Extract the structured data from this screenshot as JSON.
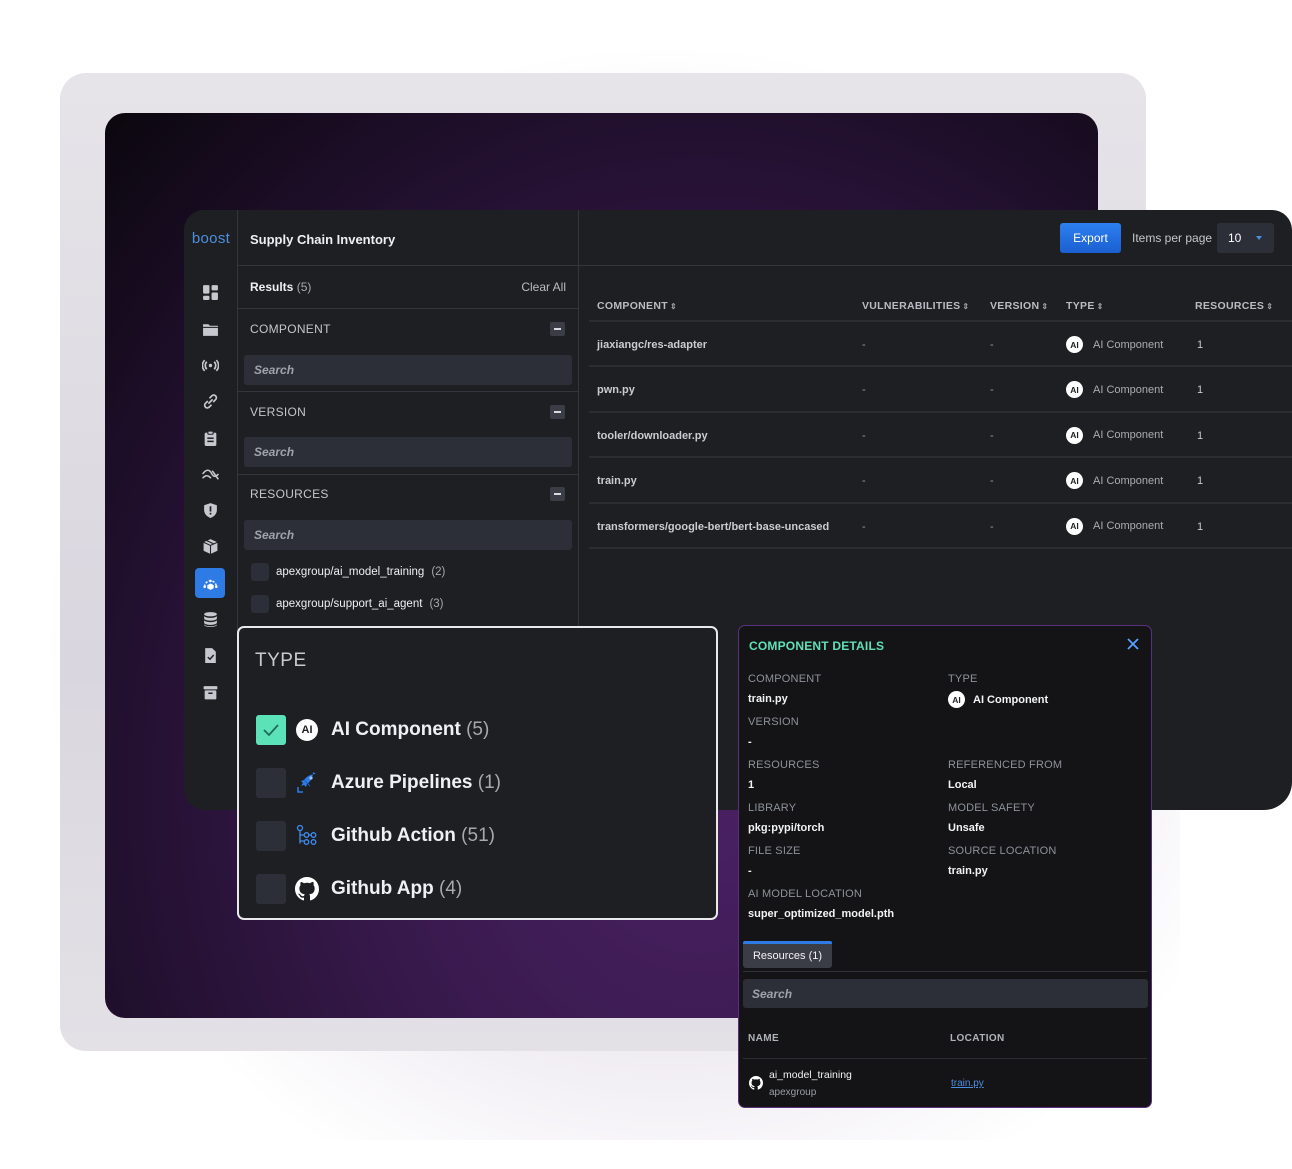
{
  "app": {
    "logo": "boost",
    "page_title": "Supply Chain Inventory",
    "accent_color": "#2f7be6"
  },
  "sidebar": {
    "items": [
      {
        "icon": "dashboard-icon",
        "active": false
      },
      {
        "icon": "folder-icon",
        "active": false
      },
      {
        "icon": "broadcast-icon",
        "active": false
      },
      {
        "icon": "link-icon",
        "active": false
      },
      {
        "icon": "clipboard-icon",
        "active": false
      },
      {
        "icon": "trend-icon",
        "active": false
      },
      {
        "icon": "shield-alert-icon",
        "active": false
      },
      {
        "icon": "package-icon",
        "active": false
      },
      {
        "icon": "supply-chain-icon",
        "active": true
      },
      {
        "icon": "database-icon",
        "active": false
      },
      {
        "icon": "file-check-icon",
        "active": false
      },
      {
        "icon": "archive-icon",
        "active": false
      }
    ]
  },
  "filters": {
    "results_label": "Results",
    "results_count": "(5)",
    "clear_all": "Clear All",
    "sections": [
      {
        "title": "COMPONENT",
        "search_placeholder": "Search"
      },
      {
        "title": "VERSION",
        "search_placeholder": "Search"
      },
      {
        "title": "RESOURCES",
        "search_placeholder": "Search"
      }
    ],
    "resources": [
      {
        "name": "apexgroup/ai_model_training",
        "count": "(2)",
        "checked": false
      },
      {
        "name": "apexgroup/support_ai_agent",
        "count": "(3)",
        "checked": false
      }
    ]
  },
  "toolbar": {
    "export_label": "Export",
    "items_per_page_label": "Items per page",
    "items_per_page_value": "10"
  },
  "table": {
    "columns": [
      "COMPONENT",
      "VULNERABILITIES",
      "VERSION",
      "TYPE",
      "RESOURCES"
    ],
    "rows": [
      {
        "component": "jiaxiangc/res-adapter",
        "vulnerabilities": "-",
        "version": "-",
        "type": "AI Component",
        "resources": "1"
      },
      {
        "component": "pwn.py",
        "vulnerabilities": "-",
        "version": "-",
        "type": "AI Component",
        "resources": "1"
      },
      {
        "component": "tooler/downloader.py",
        "vulnerabilities": "-",
        "version": "-",
        "type": "AI Component",
        "resources": "1"
      },
      {
        "component": "train.py",
        "vulnerabilities": "-",
        "version": "-",
        "type": "AI Component",
        "resources": "1"
      },
      {
        "component": "transformers/google-bert/bert-base-uncased",
        "vulnerabilities": "-",
        "version": "-",
        "type": "AI Component",
        "resources": "1"
      }
    ],
    "ai_badge": "AI"
  },
  "type_filter": {
    "title": "TYPE",
    "options": [
      {
        "label": "AI Component",
        "count": "(5)",
        "checked": true,
        "icon": "ai-icon"
      },
      {
        "label": "Azure Pipelines",
        "count": "(1)",
        "checked": false,
        "icon": "azure-pipelines-icon"
      },
      {
        "label": "Github Action",
        "count": "(51)",
        "checked": false,
        "icon": "github-action-icon"
      },
      {
        "label": "Github App",
        "count": "(4)",
        "checked": false,
        "icon": "github-icon"
      }
    ],
    "check_color": "#5be3b7"
  },
  "details": {
    "title": "COMPONENT DETAILS",
    "title_color": "#5fe0b7",
    "fields": {
      "component": {
        "label": "COMPONENT",
        "value": "train.py"
      },
      "type": {
        "label": "TYPE",
        "value": "AI Component"
      },
      "version": {
        "label": "VERSION",
        "value": "-"
      },
      "resources": {
        "label": "RESOURCES",
        "value": "1"
      },
      "referenced_from": {
        "label": "REFERENCED FROM",
        "value": "Local"
      },
      "library": {
        "label": "LIBRARY",
        "value": "pkg:pypi/torch"
      },
      "model_safety": {
        "label": "MODEL SAFETY",
        "value": "Unsafe"
      },
      "file_size": {
        "label": "FILE SIZE",
        "value": "-"
      },
      "source_location": {
        "label": "SOURCE LOCATION",
        "value": "train.py"
      },
      "ai_model_location": {
        "label": "AI MODEL LOCATION",
        "value": "super_optimized_model.pth"
      }
    },
    "tab_label": "Resources (1)",
    "search_placeholder": "Search",
    "columns": [
      "NAME",
      "LOCATION"
    ],
    "resources": [
      {
        "name": "ai_model_training",
        "org": "apexgroup",
        "location": "train.py"
      }
    ]
  }
}
